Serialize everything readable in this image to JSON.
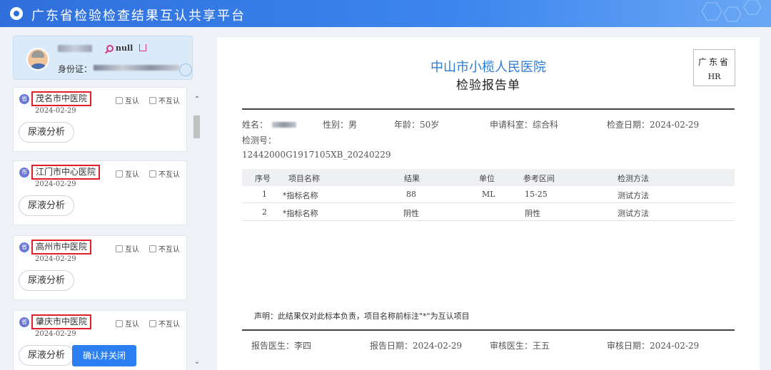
{
  "header": {
    "title": "广东省检验检查结果互认共享平台"
  },
  "patient": {
    "status_text": "null",
    "id_label": "身份证："
  },
  "hospitals": [
    {
      "badge": "省",
      "name": "茂名市中医院",
      "date": "2024-02-29",
      "mutual_label": "互认",
      "non_mutual_label": "不互认",
      "analysis_label": "尿液分析"
    },
    {
      "badge": "市",
      "name": "江门市中心医院",
      "date": "2024-02-29",
      "mutual_label": "互认",
      "non_mutual_label": "不互认",
      "analysis_label": "尿液分析"
    },
    {
      "badge": "省",
      "name": "高州市中医院",
      "date": "2024-02-29",
      "mutual_label": "互认",
      "non_mutual_label": "不互认",
      "analysis_label": "尿液分析"
    },
    {
      "badge": "省",
      "name": "肇庆市中医院",
      "date": "2024-02-29",
      "mutual_label": "互认",
      "non_mutual_label": "不互认",
      "analysis_label": "尿液分析"
    }
  ],
  "confirm_button": "确认并关闭",
  "report": {
    "hospital": "中山市小榄人民医院",
    "title": "检验报告单",
    "stamp_line1": "广东省",
    "stamp_line2": "HR",
    "name_label": "姓名：",
    "gender": "性别：男",
    "age": "年龄：50岁",
    "department": "申请科室：综合科",
    "exam_date": "检查日期：2024-02-29",
    "test_no_label": "检测号：",
    "test_no": "12442000G1917105XB_20240229",
    "columns": [
      "序号",
      "项目名称",
      "结果",
      "单位",
      "参考区间",
      "检测方法"
    ],
    "rows": [
      [
        "1",
        "*指标名称",
        "88",
        "ML",
        "15-25",
        "测试方法"
      ],
      [
        "2",
        "*指标名称",
        "阴性",
        "",
        "阴性",
        "测试方法"
      ]
    ],
    "notice": "声明：此结果仅对此标本负责，项目名称前标注\"*\"为互认项目",
    "doctor": "报告医生：李四",
    "report_date": "报告日期：2024-02-29",
    "reviewer": "审核医生：王五",
    "review_date": "审核日期：2024-02-29"
  }
}
